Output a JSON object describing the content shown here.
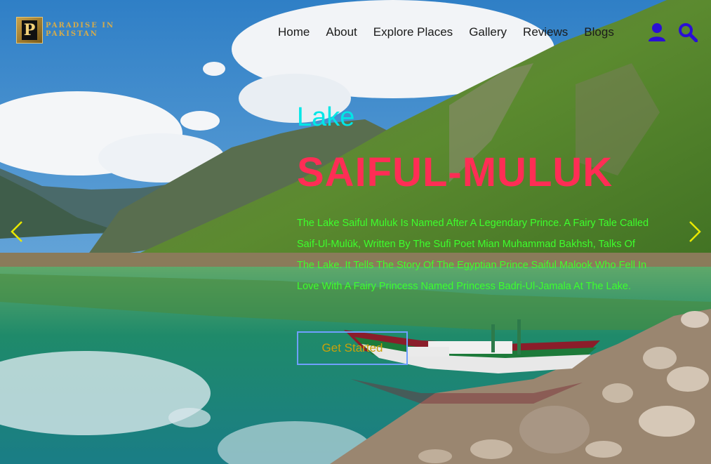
{
  "logo": {
    "letter": "P",
    "line1": "PARADISE IN",
    "line2": "PAKISTAN"
  },
  "nav": {
    "items": [
      "Home",
      "About",
      "Explore Places",
      "Gallery",
      "Reviews",
      "Blogs"
    ]
  },
  "icons": {
    "user": "user-icon",
    "search": "search-icon",
    "prev": "chevron-left-icon",
    "next": "chevron-right-icon"
  },
  "hero": {
    "kicker": "Lake",
    "title": "SAIFUL-MULUK",
    "description": "The Lake Saiful Muluk Is Named After A Legendary Prince. A Fairy Tale Called Saif-Ul-Mulūk, Written By The Sufi Poet Mian Muhammad Bakhsh, Talks Of The Lake. It Tells The Story Of The Egyptian Prince Saiful Malook Who Fell In Love With A Fairy Princess Named Princess Badri-Ul-Jamala At The Lake.",
    "cta": "Get Started"
  },
  "colors": {
    "kicker": "#00e6e6",
    "title": "#ff2d55",
    "description": "#3dff2d",
    "cta_text": "#c9a10a",
    "cta_border": "#6f9fff",
    "nav_icons": "#2a0fd6",
    "arrows": "#e8e800"
  }
}
